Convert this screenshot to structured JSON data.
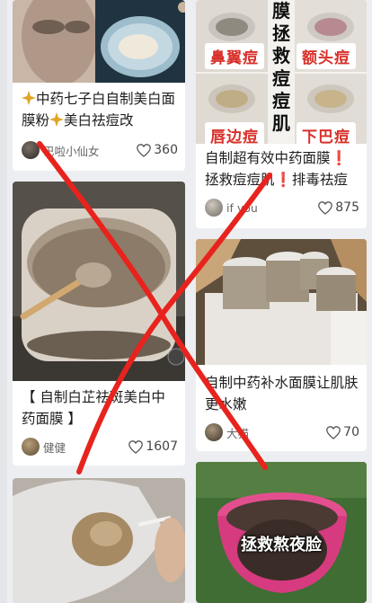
{
  "feed": {
    "left": [
      {
        "title_prefix_icon": "sparkle-icon",
        "title_a": "中药七子白自制美白面膜粉",
        "title_b": "美白祛痘改",
        "author": "巴啦小仙女",
        "likes": "360"
      },
      {
        "title": "【 自制白芷祛斑美白中药面膜 】",
        "author": "健健",
        "likes": "1607"
      },
      {
        "title": "",
        "author": "",
        "likes": ""
      }
    ],
    "right": [
      {
        "image_labels": {
          "top_left": "鼻翼痘",
          "top_right": "额头痘",
          "bottom_left": "唇边痘",
          "bottom_right": "下巴痘",
          "vertical": "膜拯救痘痘肌"
        },
        "title_a": "自制超有效中药面膜",
        "bang": "❗",
        "title_b": "拯救痘痘肌",
        "title_c": "排毒祛痘",
        "author": "if you",
        "likes": "875"
      },
      {
        "title": "自制中药补水面膜让肌肤更水嫩",
        "author": "大猫",
        "likes": "70"
      },
      {
        "image_text": "拯救熬夜脸"
      }
    ]
  },
  "colors": {
    "cross_red": "#e8231d",
    "pill_text": "#d8302a",
    "background": "#eceef1"
  }
}
